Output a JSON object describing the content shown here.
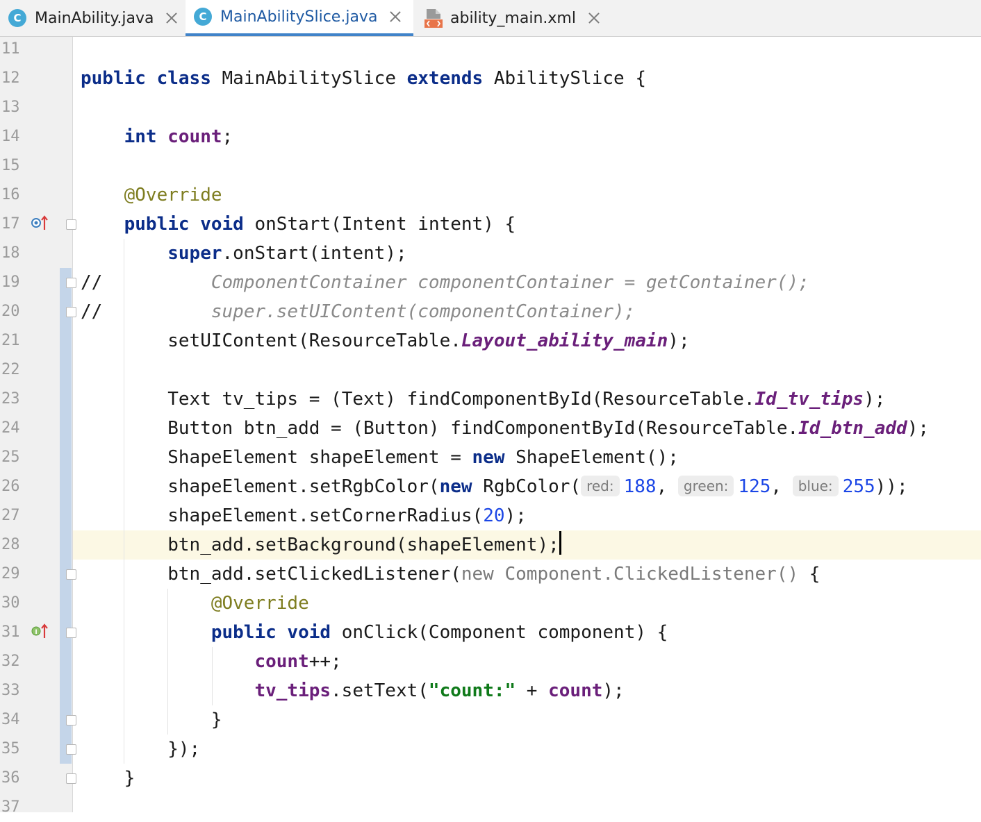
{
  "tabs": [
    {
      "name": "MainAbility.java",
      "icon": "class-icon",
      "active": false
    },
    {
      "name": "MainAbilitySlice.java",
      "icon": "class-icon",
      "active": true
    },
    {
      "name": "ability_main.xml",
      "icon": "xml-file-icon",
      "active": false
    }
  ],
  "class_icon_letter": "C",
  "gutter": {
    "line_numbers": [
      "11",
      "12",
      "13",
      "14",
      "15",
      "16",
      "17",
      "18",
      "19",
      "20",
      "21",
      "22",
      "23",
      "24",
      "25",
      "26",
      "27",
      "28",
      "29",
      "30",
      "31",
      "32",
      "33",
      "34",
      "35",
      "36",
      "37"
    ]
  },
  "code": {
    "l12": {
      "kw1": "public",
      "kw2": "class",
      "name": "MainAbilitySlice",
      "kw3": "extends",
      "rest": "AbilitySlice {"
    },
    "l14": {
      "kw": "int",
      "field": "count",
      "rest": ";"
    },
    "l16": {
      "ann": "@Override"
    },
    "l17": {
      "kw1": "public",
      "kw2": "void",
      "rest": "onStart(Intent intent) {"
    },
    "l18": {
      "kw": "super",
      "rest": ".onStart(intent);"
    },
    "l19": {
      "slashes": "//",
      "comment": "ComponentContainer componentContainer = getContainer();"
    },
    "l20": {
      "slashes": "//",
      "comment": "super.setUIContent(componentContainer);"
    },
    "l21": {
      "pre": "setUIContent(ResourceTable.",
      "sfield": "Layout_ability_main",
      "post": ");"
    },
    "l23": {
      "pre": "Text tv_tips = (Text) findComponentById(ResourceTable.",
      "sfield": "Id_tv_tips",
      "post": ");"
    },
    "l24": {
      "pre": "Button btn_add = (Button) findComponentById(ResourceTable.",
      "sfield": "Id_btn_add",
      "post": ");"
    },
    "l25": {
      "pre": "ShapeElement shapeElement = ",
      "kw": "new",
      "post": " ShapeElement();"
    },
    "l26": {
      "pre": "shapeElement.setRgbColor(",
      "kw": "new",
      "mid": " RgbColor(",
      "hint_red": "red:",
      "red": "188",
      "sep1": ", ",
      "hint_green": "green:",
      "green": "125",
      "sep2": ", ",
      "hint_blue": "blue:",
      "blue": "255",
      "post": "));"
    },
    "l27": {
      "pre": "shapeElement.setCornerRadius(",
      "num": "20",
      "post": ");"
    },
    "l28": {
      "text": "btn_add.setBackground(shapeElement);"
    },
    "l29": {
      "pre": "btn_add.setClickedListener(",
      "kw": "new",
      "anon": " Component.ClickedListener()",
      "post": " {"
    },
    "l30": {
      "ann": "@Override"
    },
    "l31": {
      "kw1": "public",
      "kw2": "void",
      "rest": "onClick(Component component) {"
    },
    "l32": {
      "field": "count",
      "post": "++;"
    },
    "l33": {
      "field1": "tv_tips",
      "mid": ".setText(",
      "str": "\"count:\"",
      "op": " + ",
      "field2": "count",
      "post": ");"
    },
    "l34": {
      "text": "}"
    },
    "l35": {
      "text": "});"
    },
    "l36": {
      "text": "}"
    }
  },
  "colors": {
    "keyword": "#0b2d89",
    "field": "#6a1f7a",
    "annotation": "#7e7d20",
    "number": "#1b46e6",
    "string": "#0f7a1a",
    "comment": "#8a8a8a",
    "active_tab_underline": "#4083c9",
    "caret_line": "#fcf8e4",
    "change_bar": "#c4d5e9"
  }
}
